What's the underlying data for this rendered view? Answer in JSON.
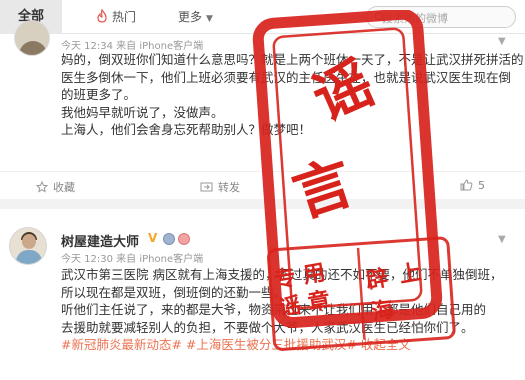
{
  "tabs": {
    "all": "全部",
    "hot": "热门",
    "more": "更多"
  },
  "search": {
    "placeholder": "搜索她的微博"
  },
  "post1": {
    "meta": "今天 12:34 来自 iPhone客户端",
    "lines": [
      "妈的，倒双班你们知道什么意思吗？就是上两个班休一天了，不是让武汉拼死拼活的",
      "医生多倒休一下，他们上班必须要有武汉的主任医生在，也就是说武汉医生现在倒",
      "的班更多了。",
      "我他妈早就听说了，没做声。",
      "上海人，他们会舍身忘死帮助别人？做梦吧！"
    ],
    "actions": {
      "favorite": "收藏",
      "repost": "转发",
      "like_count": "5"
    }
  },
  "post2": {
    "author": "树屋建造大师",
    "badge": "V",
    "meta": "今天 12:30 来自 iPhone客户端",
    "lines": [
      "武汉市第三医院 病区就有上海支援的，不过真的还不如不要，他们不单独倒班，",
      "所以现在都是双班，倒班倒的还勤一些。",
      "听他们主任说了，来的都是大爷，物资带过来不让我们用，都是他们自己用的",
      "去援助就要减轻别人的负担，不要做个大爷，人家武汉医生已经怕你们了。"
    ],
    "tags_line": "#新冠肺炎最新动态# #上海医生被分三批援助武汉# 收起全文"
  },
  "stamp": {
    "chars": [
      "谣",
      "言"
    ],
    "seal_right": "辟 上 海",
    "seal_left": "专 用 谣 章",
    "color": "#d8231c"
  },
  "colors": {
    "link": "#eb7350",
    "stamp_red": "#d8231c",
    "meta_gray": "#999999"
  }
}
